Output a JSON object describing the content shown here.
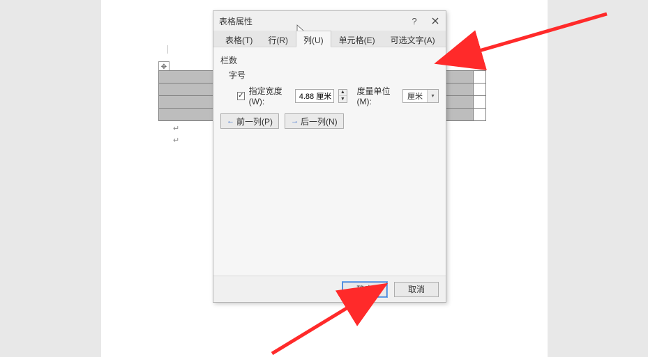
{
  "dialog": {
    "title": "表格属性",
    "help": "?",
    "tabs": {
      "table": "表格(T)",
      "row": "行(R)",
      "column": "列(U)",
      "cell": "单元格(E)",
      "alt": "可选文字(A)"
    },
    "content": {
      "section_title": "栏数",
      "sub_label": "字号",
      "width_checkbox_label": "指定宽度(W):",
      "width_checked": "✓",
      "width_value": "4.88 厘米",
      "unit_label": "度量单位(M):",
      "unit_value": "厘米",
      "prev_label": "前一列(P)",
      "next_label": "后一列(N)"
    },
    "footer": {
      "ok": "确定",
      "cancel": "取消"
    }
  },
  "marks": {
    "para": "↵",
    "table_handle": "✥"
  }
}
